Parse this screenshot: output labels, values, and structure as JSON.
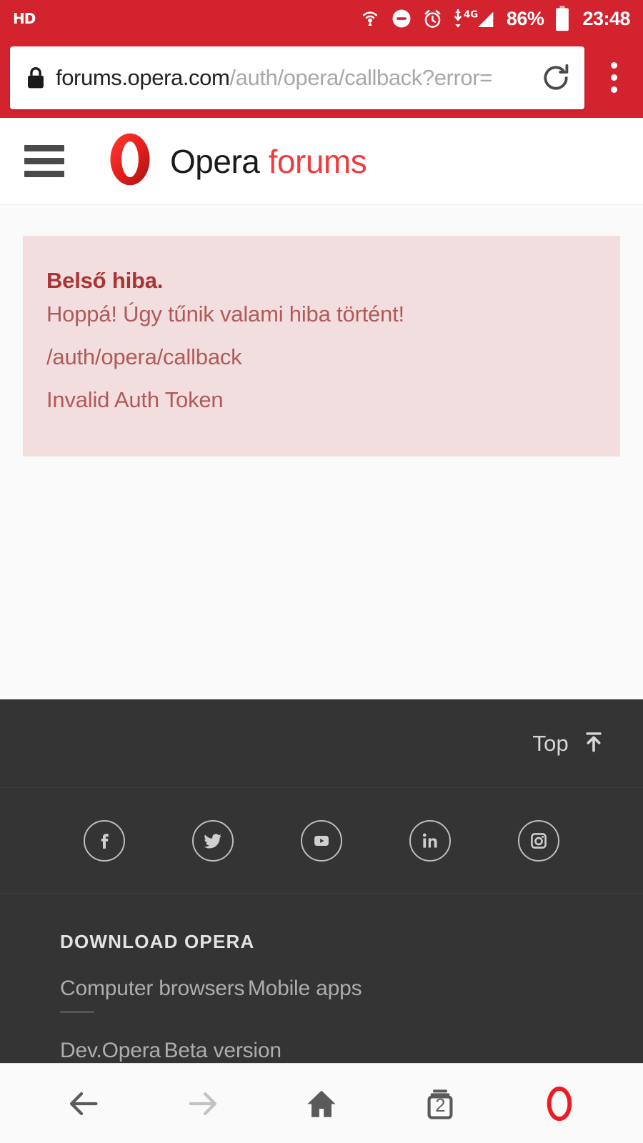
{
  "statusbar": {
    "hd_label": "HD",
    "icons": [
      "hotspot-icon",
      "do-not-disturb-icon",
      "alarm-clock-icon",
      "mobile-data-4g-icon",
      "signal-bars-icon"
    ],
    "network_label": "4G",
    "battery_percent": "86%",
    "time": "23:48"
  },
  "browser": {
    "url_domain": "forums.opera.com",
    "url_path": "/auth/opera/callback?error=",
    "lock_icon": "lock-icon",
    "reload_icon": "reload-icon",
    "menu_icon": "kebab-menu-icon"
  },
  "site_header": {
    "menu_icon": "hamburger-menu-icon",
    "logo_icon": "opera-logo-icon",
    "brand_primary": "Opera",
    "brand_secondary": "forums"
  },
  "alert": {
    "title": "Belső hiba.",
    "message": "Hoppá! Úgy tűnik valami hiba történt!",
    "path": "/auth/opera/callback",
    "detail": "Invalid Auth Token",
    "bg_color": "#f2dede",
    "text_color": "#b05a5a"
  },
  "footer": {
    "top_label": "Top",
    "top_icon": "arrow-to-top-icon",
    "social": [
      {
        "name": "facebook-icon",
        "label": "f"
      },
      {
        "name": "twitter-icon",
        "label": ""
      },
      {
        "name": "youtube-icon",
        "label": ""
      },
      {
        "name": "linkedin-icon",
        "label": "in"
      },
      {
        "name": "instagram-icon",
        "label": ""
      }
    ],
    "download_heading": "DOWNLOAD OPERA",
    "links": [
      "Computer browsers",
      "Mobile apps"
    ],
    "links2": [
      "Dev.Opera",
      "Beta version"
    ],
    "bg_color": "#343434"
  },
  "bottom_nav": {
    "back_icon": "back-arrow-icon",
    "forward_icon": "forward-arrow-icon",
    "home_icon": "home-icon",
    "tabs_icon": "tabs-icon",
    "tab_count": "2",
    "opera_icon": "opera-logo-icon"
  },
  "theme": {
    "brand_red": "#d2232f",
    "accent_red": "#ef3d3d",
    "footer_dark": "#343434",
    "page_bg": "#fafafa"
  }
}
